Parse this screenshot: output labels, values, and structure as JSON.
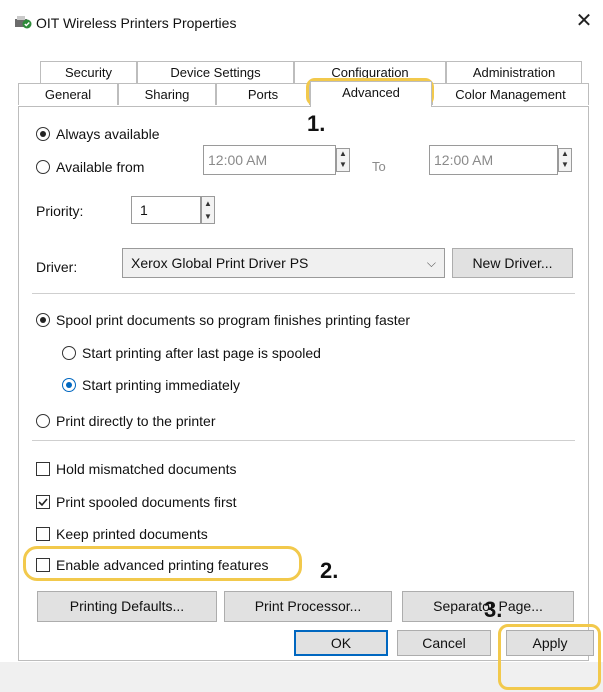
{
  "window": {
    "title": "OIT Wireless Printers Properties",
    "close_symbol": "✕"
  },
  "tabs_row1": [
    "Security",
    "Device Settings",
    "Configuration",
    "Administration"
  ],
  "tabs_row2": [
    "General",
    "Sharing",
    "Ports",
    "Advanced",
    "Color Management"
  ],
  "active_tab": "Advanced",
  "availability": {
    "always_label": "Always available",
    "from_label": "Available from",
    "from_time": "12:00 AM",
    "to_label": "To",
    "to_time": "12:00 AM"
  },
  "priority": {
    "label": "Priority:",
    "value": "1"
  },
  "driver": {
    "label": "Driver:",
    "value": "Xerox Global Print Driver PS",
    "new_driver_button": "New Driver..."
  },
  "spool": {
    "spool_label": "Spool print documents so program finishes printing faster",
    "after_last_page_label": "Start printing after last page is spooled",
    "immediately_label": "Start printing immediately",
    "direct_label": "Print directly to the printer"
  },
  "options": {
    "hold_mismatched": "Hold mismatched documents",
    "print_spooled_first": "Print spooled documents first",
    "keep_printed": "Keep printed documents",
    "enable_advanced": "Enable advanced printing features"
  },
  "buttons": {
    "printing_defaults": "Printing Defaults...",
    "print_processor": "Print Processor...",
    "separator_page": "Separator Page...",
    "ok": "OK",
    "cancel": "Cancel",
    "apply": "Apply"
  },
  "annotations": {
    "step1": "1.",
    "step2": "2.",
    "step3": "3."
  },
  "colors": {
    "highlight": "#f2c94c",
    "radio_blue": "#0067c0"
  }
}
